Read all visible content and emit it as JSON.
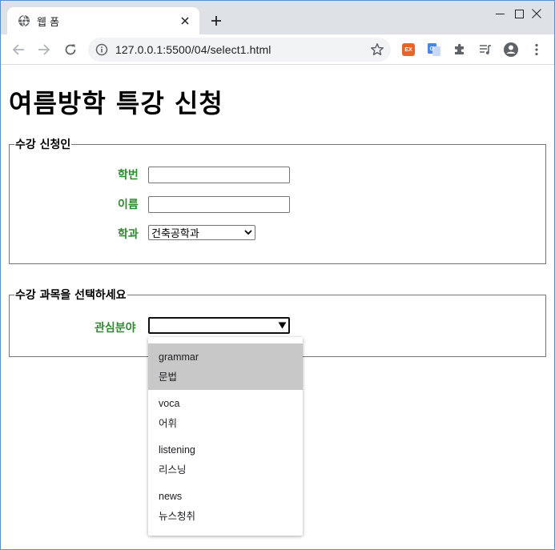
{
  "browser": {
    "tab_title": "웹 폼",
    "url": "127.0.0.1:5500/04/select1.html",
    "icons": [
      "globe-icon",
      "close-icon",
      "plus-icon",
      "minimize-icon",
      "maximize-icon",
      "window-close-icon",
      "back-arrow-icon",
      "forward-arrow-icon",
      "reload-icon",
      "info-icon",
      "star-icon",
      "extension-ex-icon",
      "google-translate-icon",
      "puzzle-icon",
      "media-queue-icon",
      "profile-icon",
      "kebab-menu-icon"
    ],
    "extension_ex_label": "EX"
  },
  "page": {
    "title": "여름방학 특강 신청",
    "fieldset1": {
      "legend": "수강 신청인",
      "student_id_label": "학번",
      "name_label": "이름",
      "dept_label": "학과",
      "dept_selected": "건축공학과"
    },
    "fieldset2": {
      "legend": "수강 과목을 선택하세요",
      "interest_label": "관심분야",
      "interest_selected": ""
    },
    "dropdown": {
      "options": [
        {
          "value": "grammar",
          "text": "문법",
          "selected": true
        },
        {
          "value": "voca",
          "text": "어휘",
          "selected": false
        },
        {
          "value": "listening",
          "text": "리스닝",
          "selected": false
        },
        {
          "value": "news",
          "text": "뉴스청취",
          "selected": false
        }
      ]
    }
  }
}
